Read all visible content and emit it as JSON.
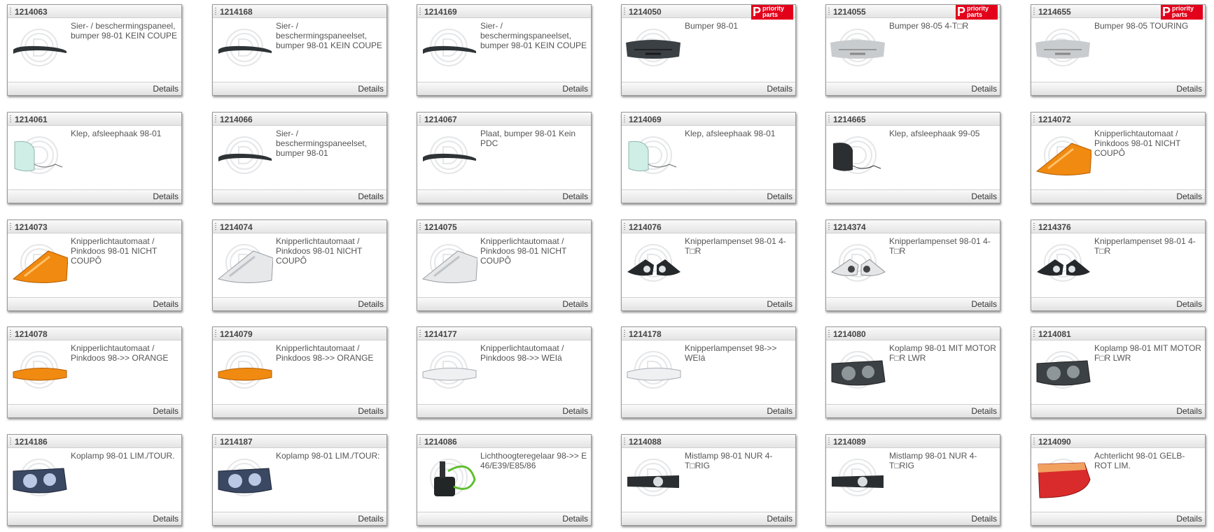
{
  "details_label": "Details",
  "badge": {
    "letter": "P",
    "line1": "priority",
    "line2": "parts"
  },
  "colors": {
    "badge": "#e3001b",
    "orange": "#f08a10",
    "dark": "#2e3336"
  },
  "products": [
    {
      "number": "1214063",
      "description": "Sier- / beschermingspaneel, bumper 98-01 KEIN COUPE",
      "icon": "trim-strip-icon",
      "priority": false
    },
    {
      "number": "1214168",
      "description": "Sier- / beschermingspaneelset, bumper 98-01 KEIN COUPE",
      "icon": "trim-strip-icon",
      "priority": false
    },
    {
      "number": "1214169",
      "description": "Sier- / beschermingspaneelset, bumper 98-01 KEIN COUPE",
      "icon": "trim-strip-icon",
      "priority": false
    },
    {
      "number": "1214050",
      "description": "Bumper 98-01",
      "icon": "bumper-dark-icon",
      "priority": true
    },
    {
      "number": "1214055",
      "description": "Bumper 98-05 4-T□R",
      "icon": "bumper-light-icon",
      "priority": true
    },
    {
      "number": "1214655",
      "description": "Bumper 98-05 TOURING",
      "icon": "bumper-light-icon",
      "priority": true
    },
    {
      "number": "1214061",
      "description": "Klep, afsleephaak 98-01",
      "icon": "tow-cover-light-icon",
      "priority": false
    },
    {
      "number": "1214066",
      "description": "Sier- / beschermingspaneelset, bumper 98-01",
      "icon": "trim-strip-icon",
      "priority": false
    },
    {
      "number": "1214067",
      "description": "Plaat, bumper 98-01 Kein PDC",
      "icon": "trim-strip-icon",
      "priority": false
    },
    {
      "number": "1214069",
      "description": "Klep, afsleephaak 98-01",
      "icon": "tow-cover-light-icon",
      "priority": false
    },
    {
      "number": "1214665",
      "description": "Klep, afsleephaak 99-05",
      "icon": "tow-cover-dark-icon",
      "priority": false
    },
    {
      "number": "1214072",
      "description": "Knipperlichtautomaat / Pinkdoos 98-01 NICHT COUPÔ",
      "icon": "corner-lamp-orange-icon",
      "priority": false
    },
    {
      "number": "1214073",
      "description": "Knipperlichtautomaat / Pinkdoos 98-01 NICHT COUPÔ",
      "icon": "corner-lamp-orange-icon",
      "priority": false
    },
    {
      "number": "1214074",
      "description": "Knipperlichtautomaat / Pinkdoos 98-01 NICHT COUPÔ",
      "icon": "corner-lamp-clear-icon",
      "priority": false
    },
    {
      "number": "1214075",
      "description": "Knipperlichtautomaat / Pinkdoos 98-01 NICHT COUPÔ",
      "icon": "corner-lamp-clear-icon",
      "priority": false
    },
    {
      "number": "1214076",
      "description": "Knipperlampenset 98-01 4-T□R",
      "icon": "lamp-pair-dark-icon",
      "priority": false
    },
    {
      "number": "1214374",
      "description": "Knipperlampenset 98-01 4-T□R",
      "icon": "lamp-pair-clear-icon",
      "priority": false
    },
    {
      "number": "1214376",
      "description": "Knipperlampenset 98-01 4-T□R",
      "icon": "lamp-pair-dark-icon",
      "priority": false
    },
    {
      "number": "1214078",
      "description": "Knipperlichtautomaat / Pinkdoos 98->> ORANGE",
      "icon": "side-marker-orange-icon",
      "priority": false
    },
    {
      "number": "1214079",
      "description": "Knipperlichtautomaat / Pinkdoos 98->> ORANGE",
      "icon": "side-marker-orange-icon",
      "priority": false
    },
    {
      "number": "1214177",
      "description": "Knipperlichtautomaat / Pinkdoos 98->> WEIá",
      "icon": "side-marker-clear-icon",
      "priority": false
    },
    {
      "number": "1214178",
      "description": "Knipperlampenset 98->> WEIá",
      "icon": "side-marker-clear-icon",
      "priority": false
    },
    {
      "number": "1214080",
      "description": "Koplamp 98-01 MIT MOTOR F□R LWR",
      "icon": "headlamp-dark-icon",
      "priority": false
    },
    {
      "number": "1214081",
      "description": "Koplamp 98-01 MIT MOTOR F□R LWR",
      "icon": "headlamp-dark-icon",
      "priority": false
    },
    {
      "number": "1214186",
      "description": "Koplamp 98-01 LIM./TOUR.",
      "icon": "headlamp-blue-icon",
      "priority": false
    },
    {
      "number": "1214187",
      "description": "Koplamp 98-01 LIM./TOUR:",
      "icon": "headlamp-blue-icon",
      "priority": false
    },
    {
      "number": "1214086",
      "description": "Lichthoogteregelaar 98->> E 46/E39/E85/86",
      "icon": "level-motor-icon",
      "priority": false
    },
    {
      "number": "1214088",
      "description": "Mistlamp 98-01 NUR 4-T□RIG",
      "icon": "fog-lamp-icon",
      "priority": false
    },
    {
      "number": "1214089",
      "description": "Mistlamp 98-01 NUR 4-T□RIG",
      "icon": "fog-lamp-icon",
      "priority": false
    },
    {
      "number": "1214090",
      "description": "Achterlicht 98-01 GELB-ROT LIM.",
      "icon": "tail-light-icon",
      "priority": false
    }
  ]
}
